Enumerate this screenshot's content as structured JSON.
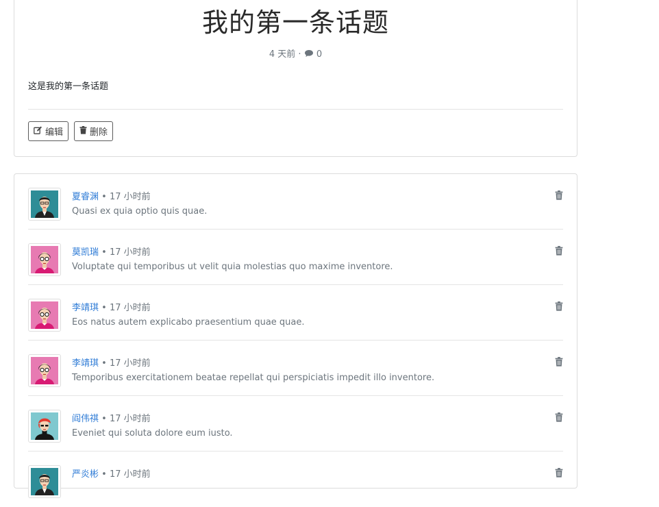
{
  "topic": {
    "title": "我的第一条话题",
    "time": "4 天前",
    "separator": "·",
    "comment_count": "0",
    "body": "这是我的第一条话题",
    "edit_label": "编辑",
    "delete_label": "删除"
  },
  "replies": [
    {
      "author": "夏睿渊",
      "sep": "•",
      "time": "17 小时前",
      "text": "Quasi ex quia optio quis quae.",
      "avatar": "man-dark-hair-teal-bg-icon"
    },
    {
      "author": "莫凯瑞",
      "sep": "•",
      "time": "17 小时前",
      "text": "Voluptate qui temporibus ut velit quia molestias quo maxime inventore.",
      "avatar": "woman-glasses-pink-bg-icon"
    },
    {
      "author": "李靖琪",
      "sep": "•",
      "time": "17 小时前",
      "text": "Eos natus autem explicabo praesentium quae quae.",
      "avatar": "woman-glasses-pink-bg-icon"
    },
    {
      "author": "李靖琪",
      "sep": "•",
      "time": "17 小时前",
      "text": "Temporibus exercitationem beatae repellat qui perspiciatis impedit illo inventore.",
      "avatar": "woman-glasses-pink-bg-icon"
    },
    {
      "author": "阎伟祺",
      "sep": "•",
      "time": "17 小时前",
      "text": "Eveniet qui soluta dolore eum iusto.",
      "avatar": "woman-red-hair-cyan-bg-icon"
    },
    {
      "author": "严炎彬",
      "sep": "•",
      "time": "17 小时前",
      "text": "",
      "avatar": "man-dark-hair-teal-bg-icon"
    }
  ],
  "colors": {
    "link": "#2e7bd6",
    "muted": "#6c757d",
    "border": "#dcdcdc"
  }
}
